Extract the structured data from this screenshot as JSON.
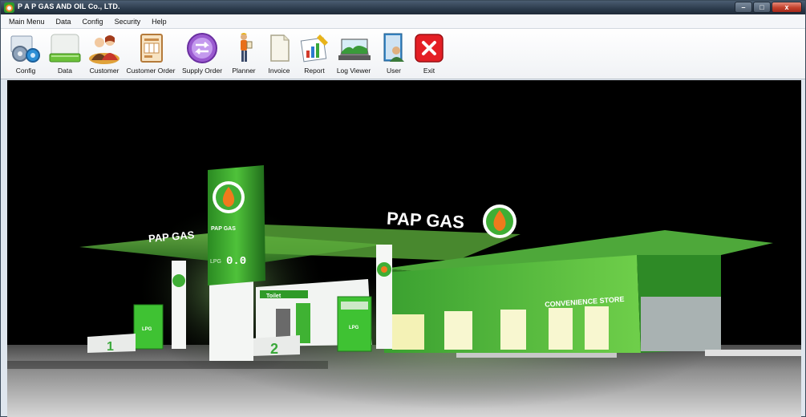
{
  "window": {
    "title": "P A P GAS AND OIL Co., LTD.",
    "controls": {
      "minimize": "–",
      "maximize": "□",
      "close": "x"
    }
  },
  "menubar": {
    "items": [
      "Main Menu",
      "Data",
      "Config",
      "Security",
      "Help"
    ]
  },
  "toolbar": {
    "items": [
      {
        "label": "Config",
        "icon": "config-gears-icon"
      },
      {
        "label": "Data",
        "icon": "data-drive-icon"
      },
      {
        "label": "Customer",
        "icon": "customer-people-icon"
      },
      {
        "label": "Customer Order",
        "icon": "customer-order-form-icon"
      },
      {
        "label": "Supply Order",
        "icon": "supply-order-arrows-icon"
      },
      {
        "label": "Planner",
        "icon": "planner-person-icon"
      },
      {
        "label": "Invoice",
        "icon": "invoice-document-icon"
      },
      {
        "label": "Report",
        "icon": "report-chart-icon"
      },
      {
        "label": "Log Viewer",
        "icon": "log-viewer-landscape-icon"
      },
      {
        "label": "User",
        "icon": "user-book-icon"
      },
      {
        "label": "Exit",
        "icon": "exit-x-icon"
      }
    ]
  },
  "scene": {
    "brand_main": "PAP GAS",
    "brand_left": "PAP GAS",
    "pylon_brand": "PAP GAS",
    "pylon_price": "0.0",
    "pylon_price_prefix": "LPG",
    "pump_label": "LPG",
    "toilet_sign": "Toilet",
    "store_sign": "CONVENIENCE STORE",
    "island_1": "1",
    "island_2": "2",
    "colors": {
      "brand_green": "#2fae35",
      "flame_orange": "#f07a1c"
    }
  }
}
